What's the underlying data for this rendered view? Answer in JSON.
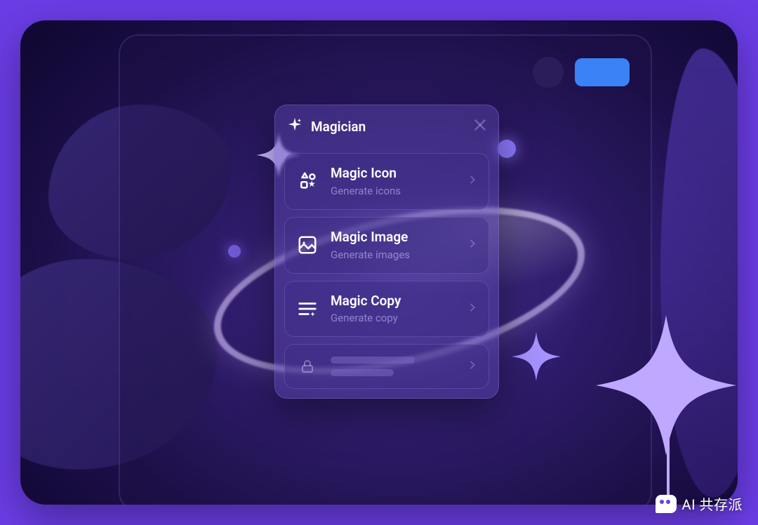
{
  "panel": {
    "title": "Magician",
    "items": [
      {
        "title": "Magic Icon",
        "subtitle": "Generate icons"
      },
      {
        "title": "Magic Image",
        "subtitle": "Generate images"
      },
      {
        "title": "Magic Copy",
        "subtitle": "Generate copy"
      }
    ]
  },
  "watermark": {
    "label": "AI 共存派"
  },
  "colors": {
    "accent": "#3b82f6",
    "panel": "#5a46aa"
  }
}
